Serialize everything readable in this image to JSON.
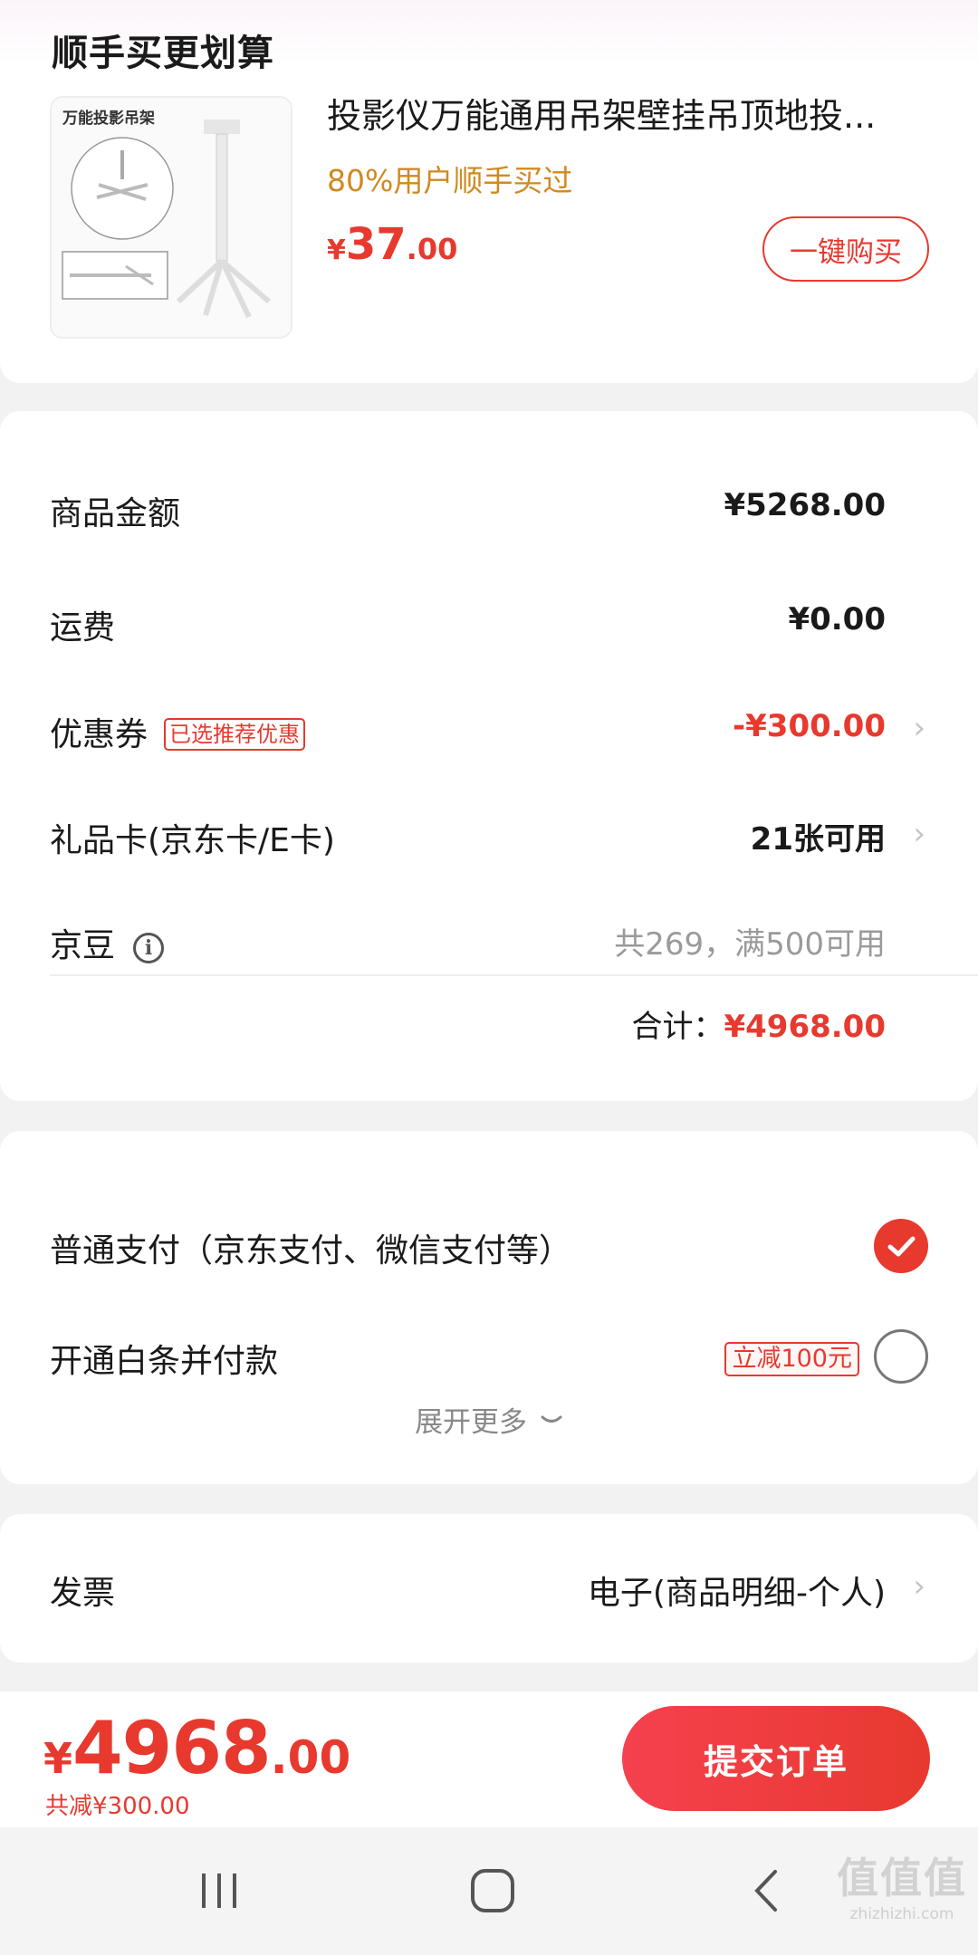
{
  "addon": {
    "title": "顺手买更划算",
    "product": {
      "image_caption": "万能投影吊架",
      "name": "投影仪万能通用吊架壁挂吊顶地投...",
      "tag": "80%用户顺手买过",
      "price_currency": "¥",
      "price_int": "37",
      "price_dec": ".00",
      "buy_label": "一键购买"
    }
  },
  "amounts": {
    "goods": {
      "label": "商品金额",
      "value": "¥5268.00"
    },
    "shipping": {
      "label": "运费",
      "value": "¥0.00"
    },
    "coupon": {
      "label": "优惠券",
      "tag": "已选推荐优惠",
      "value": "-¥300.00"
    },
    "giftcard": {
      "label": "礼品卡(京东卡/E卡)",
      "value": "21张可用"
    },
    "jingdou": {
      "label": "京豆",
      "value": "共269，满500可用"
    },
    "total": {
      "label": "合计：",
      "value": "¥4968.00"
    }
  },
  "payment": {
    "normal": {
      "label": "普通支付（京东支付、微信支付等）",
      "selected": true
    },
    "baitiao": {
      "label": "开通白条并付款",
      "promo": "立减100元",
      "selected": false
    },
    "expand_label": "展开更多"
  },
  "invoice": {
    "label": "发票",
    "value": "电子(商品明细-个人)"
  },
  "submit": {
    "currency": "¥",
    "price_int": "4968",
    "price_dec": ".00",
    "saved": "共减¥300.00",
    "button_label": "提交订单"
  },
  "watermark": {
    "big": "值值值",
    "small": "zhizhizhi.com"
  },
  "colors": {
    "accent": "#e8392f",
    "tag_orange": "#d08a1f"
  },
  "icons": [
    "info-icon",
    "chevron-right-icon",
    "check-icon",
    "chevron-down-icon",
    "recents-icon",
    "home-icon",
    "back-icon"
  ]
}
